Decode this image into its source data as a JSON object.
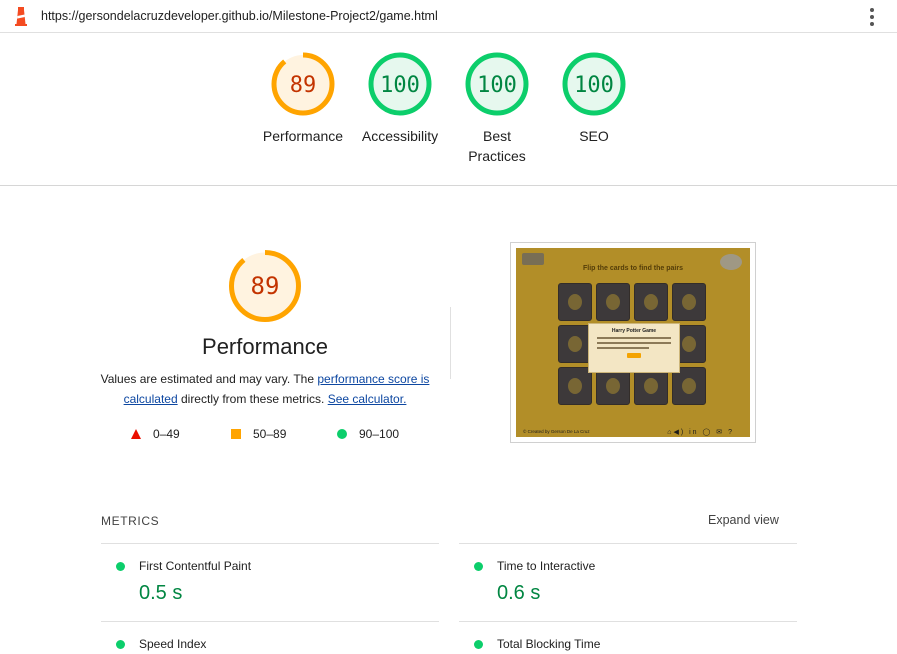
{
  "browser": {
    "url": "https://gersondelacruzdeveloper.github.io/Milestone-Project2/game.html"
  },
  "gauges": [
    {
      "score": "89",
      "label": "Performance",
      "color": "#ffa400",
      "bg": "#fff3e0",
      "text_color": "#c33300",
      "fraction": 0.89
    },
    {
      "score": "100",
      "label": "Accessibility",
      "color": "#0cce6b",
      "bg": "#e6f8ee",
      "text_color": "#018642",
      "fraction": 1.0
    },
    {
      "score": "100",
      "label": "Best Practices",
      "color": "#0cce6b",
      "bg": "#e6f8ee",
      "text_color": "#018642",
      "fraction": 1.0
    },
    {
      "score": "100",
      "label": "SEO",
      "color": "#0cce6b",
      "bg": "#e6f8ee",
      "text_color": "#018642",
      "fraction": 1.0
    }
  ],
  "performance": {
    "score": "89",
    "fraction": 0.89,
    "title": "Performance",
    "desc_prefix": "Values are estimated and may vary. The ",
    "desc_link1": "performance score is calculated",
    "desc_middle": " directly from these metrics. ",
    "desc_link2": "See calculator."
  },
  "legend": [
    {
      "shape": "triangle",
      "range": "0–49"
    },
    {
      "shape": "square",
      "range": "50–89"
    },
    {
      "shape": "circle",
      "range": "90–100"
    }
  ],
  "thumbnail": {
    "title": "Flip the cards to find the pairs",
    "modal_title": "Harry Potter Game",
    "footer": "© Created by Gerson De La Cruz",
    "icons": "⌂◀) in ◯ ✉ ?"
  },
  "metrics": {
    "heading": "METRICS",
    "expand_label": "Expand view",
    "items": [
      {
        "name": "First Contentful Paint",
        "value": "0.5 s"
      },
      {
        "name": "Time to Interactive",
        "value": "0.6 s"
      },
      {
        "name": "Speed Index",
        "value": ""
      },
      {
        "name": "Total Blocking Time",
        "value": ""
      }
    ]
  },
  "colors": {
    "pass": "#0cce6b",
    "average": "#ffa400",
    "fail": "#eb0f00"
  }
}
